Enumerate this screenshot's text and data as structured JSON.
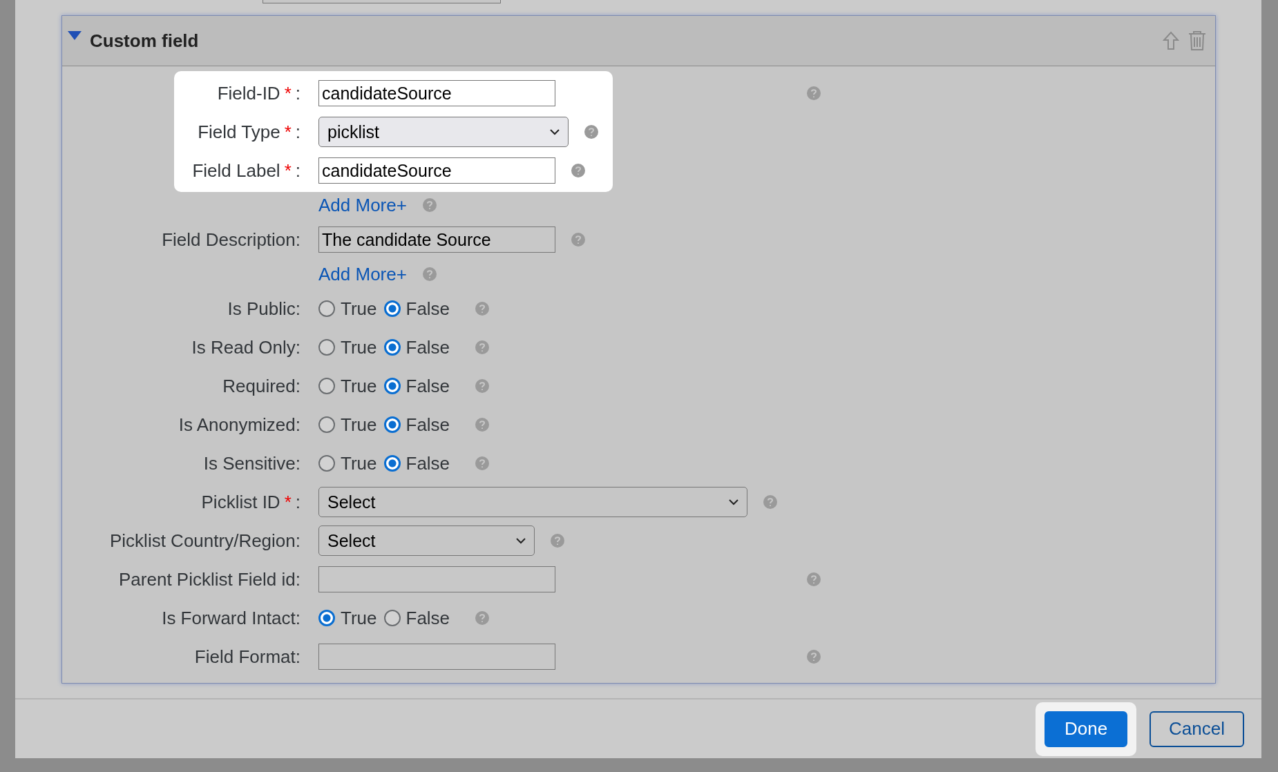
{
  "section": {
    "title": "Custom field",
    "expanded": true
  },
  "form": {
    "groups": [
      {
        "highlighted": true,
        "rows": [
          {
            "kind": "text",
            "label": "Field-ID",
            "asterisk": "*",
            "colon": ":",
            "value": "candidateSource"
          },
          {
            "kind": "select",
            "label": "Field Type",
            "asterisk": "*",
            "colon": ":",
            "value": "picklist"
          },
          {
            "kind": "text",
            "label": "Field Label",
            "asterisk": "*",
            "colon": ":",
            "value": "candidateSource"
          }
        ]
      },
      {
        "highlighted": false,
        "rows": [
          {
            "kind": "link",
            "value": "Add More+"
          },
          {
            "kind": "text",
            "label": "Field Description:",
            "value": "The candidate Source"
          },
          {
            "kind": "link",
            "value": "Add More+"
          },
          {
            "kind": "radio",
            "label": "Is Public:",
            "options": [
              {
                "label": "True",
                "selected": false
              },
              {
                "label": "False",
                "selected": true
              }
            ]
          },
          {
            "kind": "radio",
            "label": "Is Read Only:",
            "options": [
              {
                "label": "True",
                "selected": false
              },
              {
                "label": "False",
                "selected": true
              }
            ]
          },
          {
            "kind": "radio",
            "label": "Required:",
            "options": [
              {
                "label": "True",
                "selected": false
              },
              {
                "label": "False",
                "selected": true
              }
            ]
          },
          {
            "kind": "radio",
            "label": "Is Anonymized:",
            "options": [
              {
                "label": "True",
                "selected": false
              },
              {
                "label": "False",
                "selected": true
              }
            ]
          },
          {
            "kind": "radio",
            "label": "Is Sensitive:",
            "options": [
              {
                "label": "True",
                "selected": false
              },
              {
                "label": "False",
                "selected": true
              }
            ]
          },
          {
            "kind": "select",
            "label": "Picklist ID",
            "asterisk": "*",
            "colon": ":",
            "value": "Select"
          },
          {
            "kind": "select",
            "label": "Picklist Country/Region:",
            "value": "Select"
          },
          {
            "kind": "text",
            "label": "Parent Picklist Field id:",
            "value": ""
          },
          {
            "kind": "radio",
            "label": "Is Forward Intact:",
            "options": [
              {
                "label": "True",
                "selected": true
              },
              {
                "label": "False",
                "selected": false
              }
            ]
          },
          {
            "kind": "text",
            "label": "Field Format:",
            "value": ""
          }
        ]
      }
    ]
  },
  "buttons": [
    {
      "label": "Done",
      "primary": true,
      "highlighted": true
    },
    {
      "label": "Cancel",
      "primary": false,
      "highlighted": false
    }
  ]
}
